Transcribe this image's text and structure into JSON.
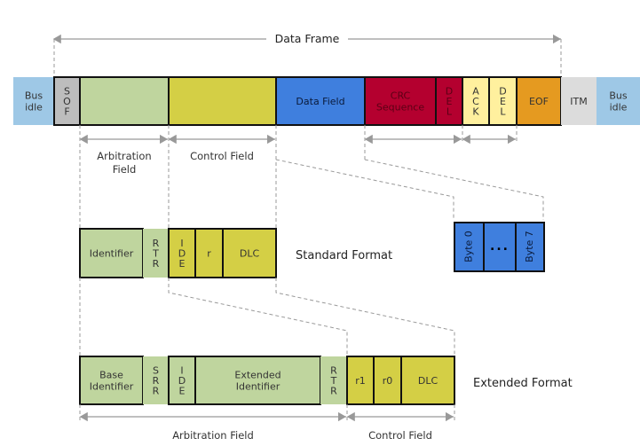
{
  "title": "Data Frame",
  "colors": {
    "bus_idle": "#9ec8e6",
    "sof": "#bdbdbd",
    "arbitration": "#bfd59e",
    "control": "#d4cf45",
    "data": "#3f7fde",
    "crc": "#b4002f",
    "ack": "#fff09e",
    "eof": "#e59a20",
    "itm": "#dcdcdc",
    "line": "#999999",
    "border": "#111111"
  },
  "frame": {
    "cells": [
      {
        "id": "bus-idle-left",
        "text": [
          "Bus",
          "idle"
        ],
        "color": "bus_idle"
      },
      {
        "id": "sof",
        "text": [
          "S",
          "O",
          "F"
        ],
        "color": "sof"
      },
      {
        "id": "arbitration",
        "text": [],
        "color": "arbitration"
      },
      {
        "id": "control",
        "text": [],
        "color": "control"
      },
      {
        "id": "data-field",
        "text": [
          "Data Field"
        ],
        "color": "data"
      },
      {
        "id": "crc-sequence",
        "text": [
          "CRC",
          "Sequence"
        ],
        "color": "crc"
      },
      {
        "id": "crc-delimiter",
        "text": [
          "D",
          "E",
          "L"
        ],
        "color": "crc"
      },
      {
        "id": "ack",
        "text": [
          "A",
          "C",
          "K"
        ],
        "color": "ack"
      },
      {
        "id": "ack-delimiter",
        "text": [
          "D",
          "E",
          "L"
        ],
        "color": "ack"
      },
      {
        "id": "eof",
        "text": [
          "EOF"
        ],
        "color": "eof"
      },
      {
        "id": "itm",
        "text": [
          "ITM"
        ],
        "color": "itm"
      },
      {
        "id": "bus-idle-right",
        "text": [
          "Bus",
          "idle"
        ],
        "color": "bus_idle"
      }
    ],
    "arbitration_label": [
      "Arbitration",
      "Field"
    ],
    "control_label": "Control Field"
  },
  "standard": {
    "label": "Standard Format",
    "cells": [
      {
        "id": "identifier",
        "text": [
          "Identifier"
        ],
        "color": "arbitration"
      },
      {
        "id": "rtr",
        "text": [
          "R",
          "T",
          "R"
        ],
        "color": "arbitration"
      },
      {
        "id": "ide",
        "text": [
          "I",
          "D",
          "E"
        ],
        "color": "control"
      },
      {
        "id": "r",
        "text": [
          "r"
        ],
        "color": "control"
      },
      {
        "id": "dlc",
        "text": [
          "DLC"
        ],
        "color": "control"
      }
    ]
  },
  "data_bytes": {
    "cells": [
      {
        "id": "byte-0",
        "text": "Byte 0"
      },
      {
        "id": "ellipsis",
        "text": "..."
      },
      {
        "id": "byte-7",
        "text": "Byte 7"
      }
    ]
  },
  "extended": {
    "label": "Extended Format",
    "cells": [
      {
        "id": "base-identifier",
        "text": [
          "Base",
          "Identifier"
        ],
        "color": "arbitration"
      },
      {
        "id": "srr",
        "text": [
          "S",
          "R",
          "R"
        ],
        "color": "arbitration"
      },
      {
        "id": "ide",
        "text": [
          "I",
          "D",
          "E"
        ],
        "color": "arbitration"
      },
      {
        "id": "extended-identifier",
        "text": [
          "Extended",
          "Identifier"
        ],
        "color": "arbitration"
      },
      {
        "id": "rtr",
        "text": [
          "R",
          "T",
          "R"
        ],
        "color": "arbitration"
      },
      {
        "id": "r1",
        "text": [
          "r1"
        ],
        "color": "control"
      },
      {
        "id": "r0",
        "text": [
          "r0"
        ],
        "color": "control"
      },
      {
        "id": "dlc",
        "text": [
          "DLC"
        ],
        "color": "control"
      }
    ],
    "arbitration_label": "Arbitration Field",
    "control_label": "Control Field"
  }
}
